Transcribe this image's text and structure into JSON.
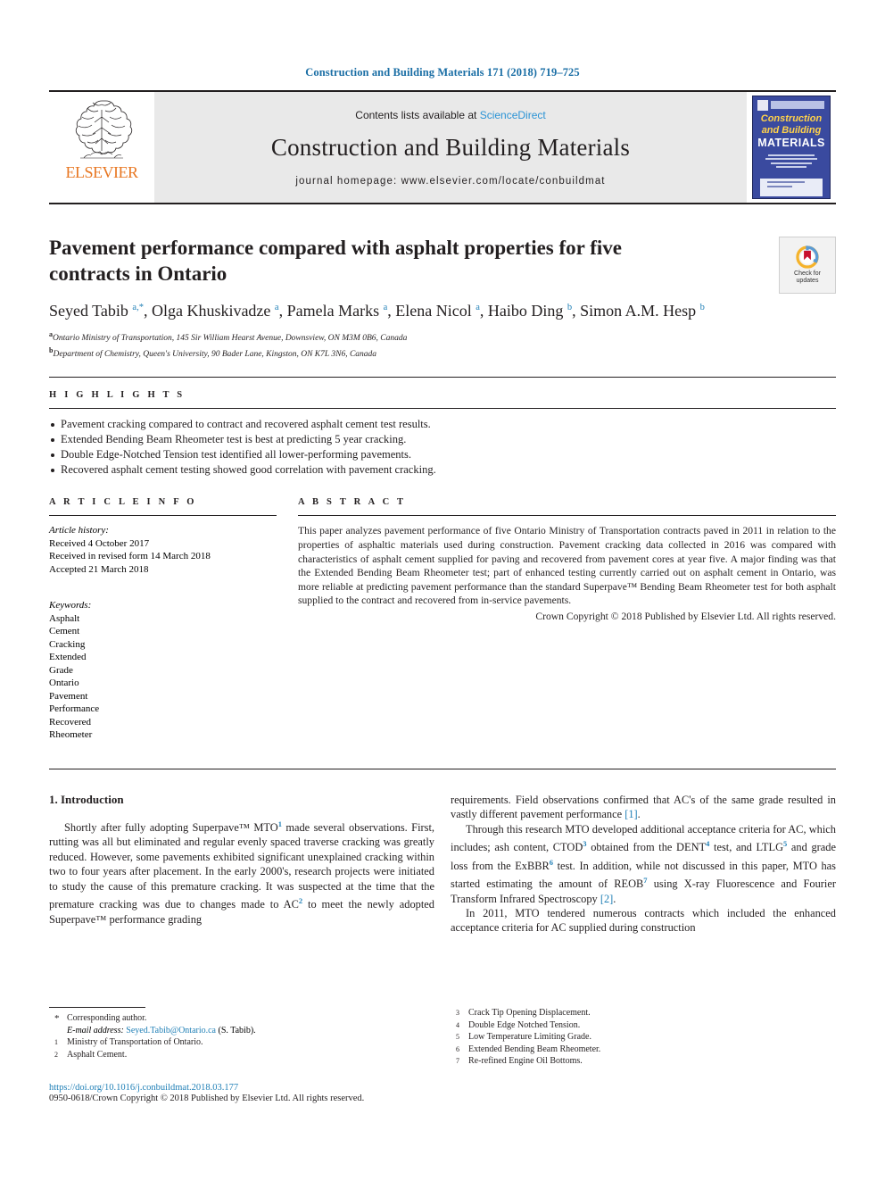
{
  "running_head": "Construction and Building Materials 171 (2018) 719–725",
  "masthead": {
    "publisher_name": "ELSEVIER",
    "contents_prefix": "Contents lists available at ",
    "contents_link": "ScienceDirect",
    "journal_title": "Construction and Building Materials",
    "homepage": "journal homepage: www.elsevier.com/locate/conbuildmat",
    "cover": {
      "line1": "Construction",
      "line2": "and Building",
      "line3": "MATERIALS"
    }
  },
  "article": {
    "title": "Pavement performance compared with asphalt properties for five contracts in Ontario",
    "crossmark_label_1": "Check for",
    "crossmark_label_2": "updates",
    "authors_html": "Seyed Tabib <sup>a,</sup><sup>*</sup>, Olga Khuskivadze <sup>a</sup>, Pamela Marks <sup>a</sup>, Elena Nicol <sup>a</sup>, Haibo Ding <sup>b</sup>, Simon A.M. Hesp <sup>b</sup>",
    "affiliations": [
      "Ontario Ministry of Transportation, 145 Sir William Hearst Avenue, Downsview, ON M3M 0B6, Canada",
      "Department of Chemistry, Queen's University, 90 Bader Lane, Kingston, ON K7L 3N6, Canada"
    ],
    "affiliation_marks": [
      "a",
      "b"
    ]
  },
  "highlights": {
    "heading": "H I G H L I G H T S",
    "items": [
      "Pavement cracking compared to contract and recovered asphalt cement test results.",
      "Extended Bending Beam Rheometer test is best at predicting 5 year cracking.",
      "Double Edge-Notched Tension test identified all lower-performing pavements.",
      "Recovered asphalt cement testing showed good correlation with pavement cracking."
    ]
  },
  "article_info": {
    "heading": "A R T I C L E    I N F O",
    "history_label": "Article history:",
    "history": [
      "Received 4 October 2017",
      "Received in revised form 14 March 2018",
      "Accepted 21 March 2018"
    ],
    "keywords_label": "Keywords:",
    "keywords": [
      "Asphalt",
      "Cement",
      "Cracking",
      "Extended",
      "Grade",
      "Ontario",
      "Pavement",
      "Performance",
      "Recovered",
      "Rheometer"
    ]
  },
  "abstract": {
    "heading": "A B S T R A C T",
    "body": "This paper analyzes pavement performance of five Ontario Ministry of Transportation contracts paved in 2011 in relation to the properties of asphaltic materials used during construction. Pavement cracking data collected in 2016 was compared with characteristics of asphalt cement supplied for paving and recovered from pavement cores at year five. A major finding was that the Extended Bending Beam Rheometer test; part of enhanced testing currently carried out on asphalt cement in Ontario, was more reliable at predicting pavement performance than the standard Superpave™ Bending Beam Rheometer test for both asphalt supplied to the contract and recovered from in-service pavements.",
    "copyright": "Crown Copyright © 2018 Published by Elsevier Ltd. All rights reserved."
  },
  "introduction": {
    "heading": "1. Introduction",
    "left_para_1_html": "Shortly after fully adopting Superpave™ MTO<sup>1</sup> made several observations. First, rutting was all but eliminated and regular evenly spaced traverse cracking was greatly reduced. However, some pavements exhibited significant unexplained cracking within two to four years after placement. In the early 2000's, research projects were initiated to study the cause of this premature cracking. It was suspected at the time that the premature cracking was due to changes made to AC<sup>2</sup> to meet the newly adopted Superpave™ performance grading",
    "right_para_1_html": "requirements. Field observations confirmed that AC's of the same grade resulted in vastly different pavement performance <span class=\"ref\">[1]</span>.",
    "right_para_2_html": "Through this research MTO developed additional acceptance criteria for AC, which includes; ash content, CTOD<sup>3</sup> obtained from the DENT<sup>4</sup> test, and LTLG<sup>5</sup> and grade loss from the ExBBR<sup>6</sup> test. In addition, while not discussed in this paper, MTO has started estimating the amount of REOB<sup>7</sup> using X-ray Fluorescence and Fourier Transform Infrared Spectroscopy <span class=\"ref\">[2]</span>.",
    "right_para_3_html": "In 2011, MTO tendered numerous contracts which included the enhanced acceptance criteria for AC supplied during construction"
  },
  "footnotes": {
    "left": [
      {
        "mark": "*",
        "text": "Corresponding author."
      },
      {
        "mark": "1",
        "text": "Ministry of Transportation of Ontario."
      },
      {
        "mark": "2",
        "text": "Asphalt Cement."
      }
    ],
    "email_label": "E-mail address:",
    "email": "Seyed.Tabib@Ontario.ca",
    "email_suffix": "(S. Tabib).",
    "right": [
      {
        "mark": "3",
        "text": "Crack Tip Opening Displacement."
      },
      {
        "mark": "4",
        "text": "Double Edge Notched Tension."
      },
      {
        "mark": "5",
        "text": "Low Temperature Limiting Grade."
      },
      {
        "mark": "6",
        "text": "Extended Bending Beam Rheometer."
      },
      {
        "mark": "7",
        "text": "Re-refined Engine Oil Bottoms."
      }
    ]
  },
  "footer": {
    "doi": "https://doi.org/10.1016/j.conbuildmat.2018.03.177",
    "copyright": "0950-0618/Crown Copyright © 2018 Published by Elsevier Ltd. All rights reserved."
  },
  "colors": {
    "link": "#1f7fb6",
    "sciencedirect": "#2a93d5",
    "elsevier_orange": "#e87722",
    "cover_blue": "#3a4a9f",
    "cover_yellow": "#ffd24a",
    "band_gray": "#e9e9e9"
  }
}
